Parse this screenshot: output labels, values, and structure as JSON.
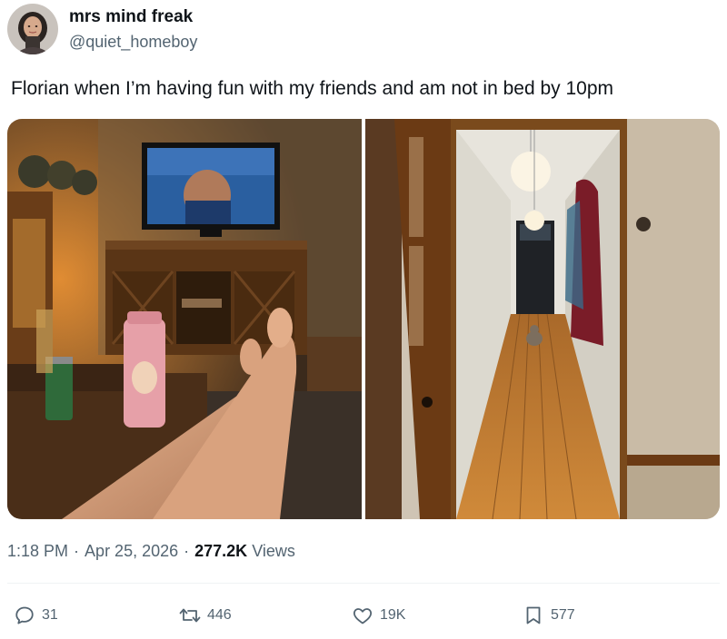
{
  "author": {
    "display_name": "mrs mind freak",
    "handle": "@quiet_homeboy"
  },
  "tweet": {
    "text": "Florian when I’m having fun with my friends and am not in bed by 10pm"
  },
  "meta": {
    "time": "1:18 PM",
    "date": "Apr 25, 2026",
    "views_count": "277.2K",
    "views_label": "Views"
  },
  "actions": {
    "replies": "31",
    "reposts": "446",
    "likes": "19K",
    "bookmarks": "577"
  },
  "icons": {
    "reply": "reply-icon",
    "repost": "repost-icon",
    "like": "heart-icon",
    "bookmark": "bookmark-icon"
  },
  "colors": {
    "text_primary": "#0f1419",
    "text_secondary": "#536471",
    "divider": "#eff3f4"
  }
}
